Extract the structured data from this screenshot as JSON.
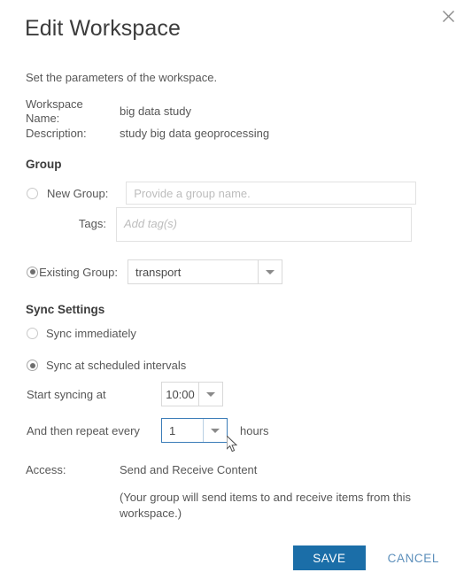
{
  "dialog": {
    "title": "Edit Workspace",
    "close_icon": "close-icon",
    "intro": "Set the parameters of the workspace."
  },
  "details": {
    "name_label": "Workspace Name:",
    "name_value": "big data study",
    "description_label": "Description:",
    "description_value": "study big data geoprocessing"
  },
  "group": {
    "heading": "Group",
    "new_group_label": "New Group:",
    "new_group_value": "",
    "new_group_placeholder": "Provide a group name.",
    "tags_label": "Tags:",
    "tags_value": "",
    "tags_placeholder": "Add tag(s)",
    "existing_group_label": "Existing Group:",
    "existing_group_value": "transport",
    "selected_option": "existing_group"
  },
  "sync": {
    "heading": "Sync Settings",
    "immediate_label": "Sync immediately",
    "scheduled_label": "Sync at scheduled intervals",
    "selected_option": "scheduled",
    "start_label": "Start syncing at",
    "start_value": "10:00",
    "repeat_label": "And then repeat every",
    "repeat_value": "1",
    "repeat_suffix": "hours"
  },
  "access": {
    "label": "Access:",
    "value": "Send and Receive Content",
    "note": "(Your group will send items to and receive items from this workspace.)"
  },
  "footer": {
    "save_label": "SAVE",
    "cancel_label": "CANCEL"
  },
  "colors": {
    "accent": "#1b6ea8",
    "cancel_text": "#5c8fbb",
    "focus_border": "#3b7cb8",
    "text": "#575757",
    "title": "#3c3c3c"
  }
}
